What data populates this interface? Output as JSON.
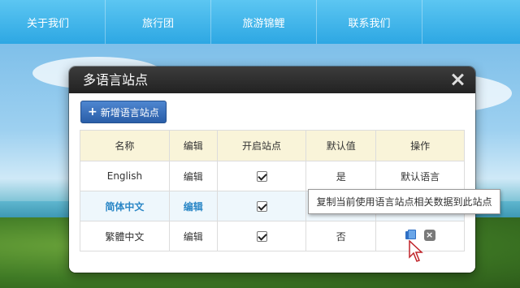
{
  "nav": {
    "items": [
      "关于我们",
      "旅行团",
      "旅游锦鲤",
      "联系我们"
    ]
  },
  "dialog": {
    "title": "多语言站点",
    "add_button_label": "新增语言站点",
    "columns": [
      "名称",
      "编辑",
      "开启站点",
      "默认值",
      "操作"
    ],
    "rows": [
      {
        "name": "English",
        "edit": "编辑",
        "enabled": true,
        "default": "是",
        "action": "默认语言"
      },
      {
        "name": "简体中文",
        "edit": "编辑",
        "enabled": true,
        "default": "",
        "action": ""
      },
      {
        "name": "繁體中文",
        "edit": "编辑",
        "enabled": true,
        "default": "否",
        "action": ""
      }
    ]
  },
  "tooltip": "复制当前使用语言站点相关数据到此站点",
  "colors": {
    "nav": "#2da7e3",
    "link": "#2b87c6",
    "header_bg": "#f9f4d9",
    "button": "#2a5ea8"
  }
}
